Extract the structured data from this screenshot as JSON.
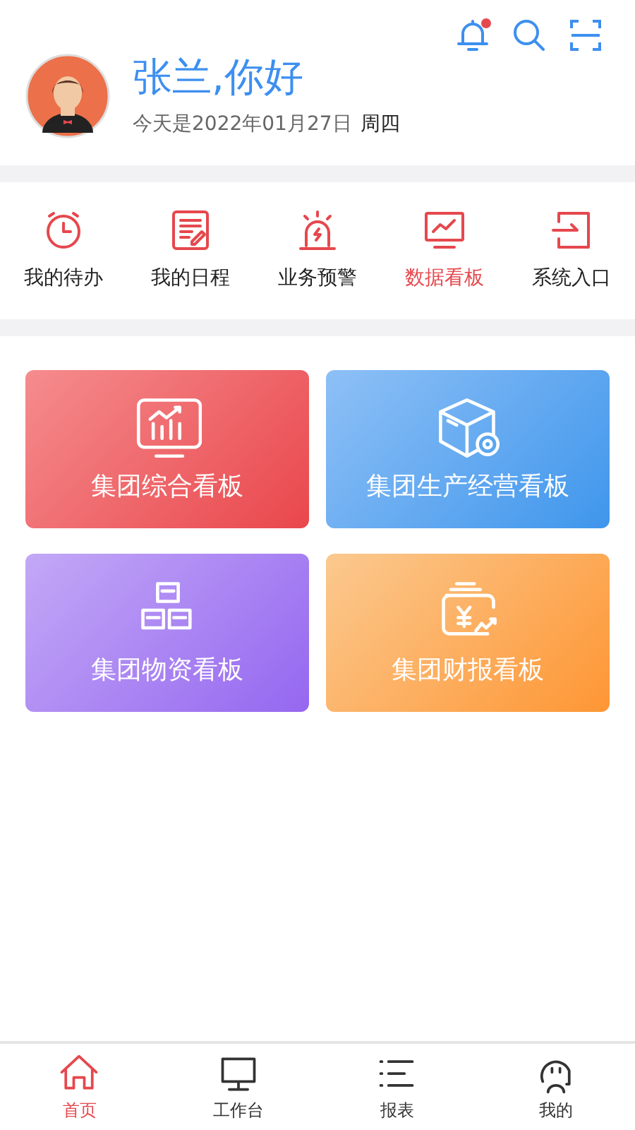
{
  "header": {
    "greeting": "张兰,你好",
    "date": "今天是2022年01月27日",
    "weekday": "周四",
    "unread": true
  },
  "shortcuts": [
    {
      "label": "我的待办",
      "kind": "clock",
      "selected": false
    },
    {
      "label": "我的日程",
      "kind": "note",
      "selected": false
    },
    {
      "label": "业务预警",
      "kind": "alarm",
      "selected": false
    },
    {
      "label": "数据看板",
      "kind": "monitor",
      "selected": true
    },
    {
      "label": "系统入口",
      "kind": "enter",
      "selected": false
    }
  ],
  "boards": [
    {
      "label": "集团综合看板",
      "kind": "chart"
    },
    {
      "label": "集团生产经营看板",
      "kind": "box"
    },
    {
      "label": "集团物资看板",
      "kind": "blocks"
    },
    {
      "label": "集团财报看板",
      "kind": "money"
    }
  ],
  "tabbar": [
    {
      "label": "首页",
      "kind": "home",
      "selected": true
    },
    {
      "label": "工作台",
      "kind": "desktop",
      "selected": false
    },
    {
      "label": "报表",
      "kind": "list",
      "selected": false
    },
    {
      "label": "我的",
      "kind": "face",
      "selected": false
    }
  ]
}
